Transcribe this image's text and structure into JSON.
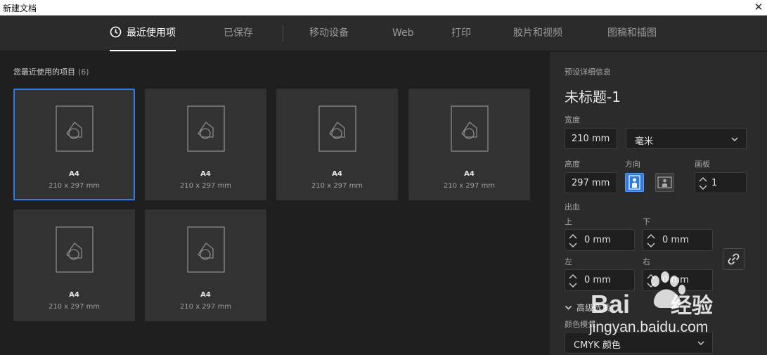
{
  "window": {
    "title": "新建文档",
    "close": "✕"
  },
  "tabs": [
    {
      "label": "最近使用项",
      "active": true
    },
    {
      "label": "已保存"
    },
    {
      "label": "移动设备"
    },
    {
      "label": "Web"
    },
    {
      "label": "打印"
    },
    {
      "label": "胶片和视频"
    },
    {
      "label": "图稿和插图"
    }
  ],
  "recent": {
    "heading": "您最近使用的项目",
    "count": "(6)",
    "items": [
      {
        "name": "A4",
        "size": "210 x 297 mm",
        "selected": true
      },
      {
        "name": "A4",
        "size": "210 x 297 mm"
      },
      {
        "name": "A4",
        "size": "210 x 297 mm"
      },
      {
        "name": "A4",
        "size": "210 x 297 mm"
      },
      {
        "name": "A4",
        "size": "210 x 297 mm"
      },
      {
        "name": "A4",
        "size": "210 x 297 mm"
      }
    ]
  },
  "preset": {
    "section_label": "预设详细信息",
    "doc_name": "未标题-1",
    "width_label": "宽度",
    "width_value": "210 mm",
    "unit_value": "毫米",
    "height_label": "高度",
    "height_value": "297 mm",
    "orientation_label": "方向",
    "artboards_label": "画板",
    "artboards_value": "1",
    "bleed_label": "出血",
    "bleed_top_label": "上",
    "bleed_top": "0 mm",
    "bleed_bottom_label": "下",
    "bleed_bottom": "0 mm",
    "bleed_left_label": "左",
    "bleed_left": "0 mm",
    "bleed_right_label": "右",
    "bleed_right": "0 mm",
    "advanced_label": "高级选项",
    "color_mode_label": "颜色模式",
    "color_mode_value": "CMYK 颜色"
  },
  "watermark": {
    "brand": "Bai",
    "brand2": "经验",
    "url": "jingyan.baidu.com"
  },
  "colors": {
    "accent": "#2d7be5",
    "panel": "#2b2b2b",
    "bg": "#1f1f1f",
    "card": "#323232"
  }
}
